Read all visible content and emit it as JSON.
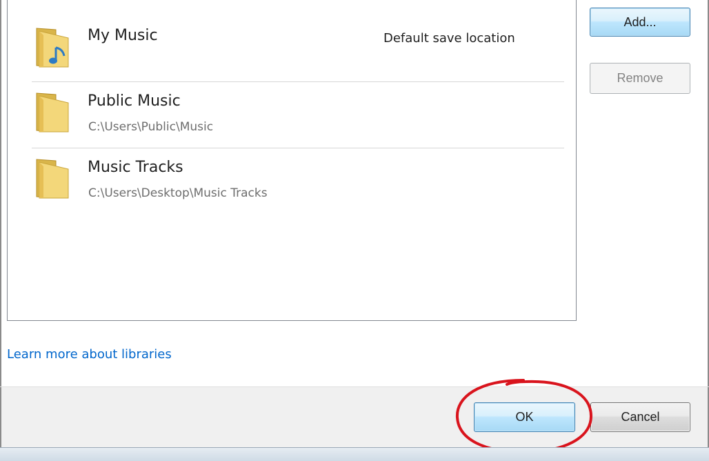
{
  "libraries": [
    {
      "name": "My Music",
      "path": "",
      "note": "Default save location",
      "icon": "music-folder-icon"
    },
    {
      "name": "Public Music",
      "path": "C:\\Users\\Public\\Music",
      "note": "",
      "icon": "folder-icon"
    },
    {
      "name": "Music Tracks",
      "path": "C:\\Users\\Desktop\\Music Tracks",
      "note": "",
      "icon": "folder-icon"
    }
  ],
  "side_buttons": {
    "add_label": "Add...",
    "remove_label": "Remove"
  },
  "link": {
    "learn_more": "Learn more about libraries"
  },
  "footer": {
    "ok_label": "OK",
    "cancel_label": "Cancel"
  },
  "colors": {
    "link": "#0066cc",
    "highlight_circle": "#d9141d",
    "default_button_border": "#3c7fb1"
  }
}
